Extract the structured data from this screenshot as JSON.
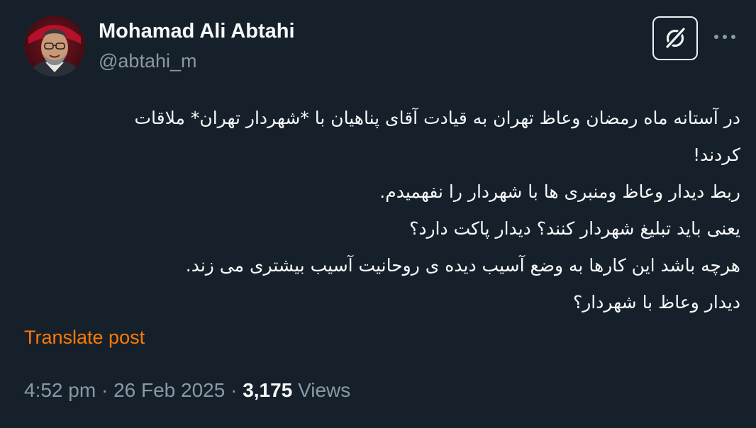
{
  "author": {
    "display_name": "Mohamad Ali Abtahi",
    "handle": "@abtahi_m",
    "avatar_icon": "profile-photo"
  },
  "actions": {
    "grok_icon": "grok-icon",
    "more_icon": "more-icon"
  },
  "post": {
    "lines": [
      "در آستانه ماه رمضان وعاظ تهران به قیادت آقای پناهیان با *شهردار تهران* ملاقات",
      "کردند!",
      "ربط دیدار وعاظ ومنبری ها با شهردار را نفهمیدم.",
      "یعنی باید تبلیغ شهردار کنند؟ دیدار پاکت دارد؟",
      "هرچه باشد این کارها به وضع آسیب دیده ی روحانیت آسیب بیشتری می زند.",
      "دیدار وعاظ با شهردار؟"
    ],
    "translate_label": "Translate post"
  },
  "meta": {
    "time": "4:52 pm",
    "separator": "·",
    "date": "26 Feb 2025",
    "views_count": "3,175",
    "views_label": "Views"
  },
  "colors": {
    "background": "#15202b",
    "primary_text": "#f7f9f9",
    "secondary_text": "#8b98a5",
    "translate_link": "#ff7a00",
    "avatar_ring": "#c4122f"
  }
}
